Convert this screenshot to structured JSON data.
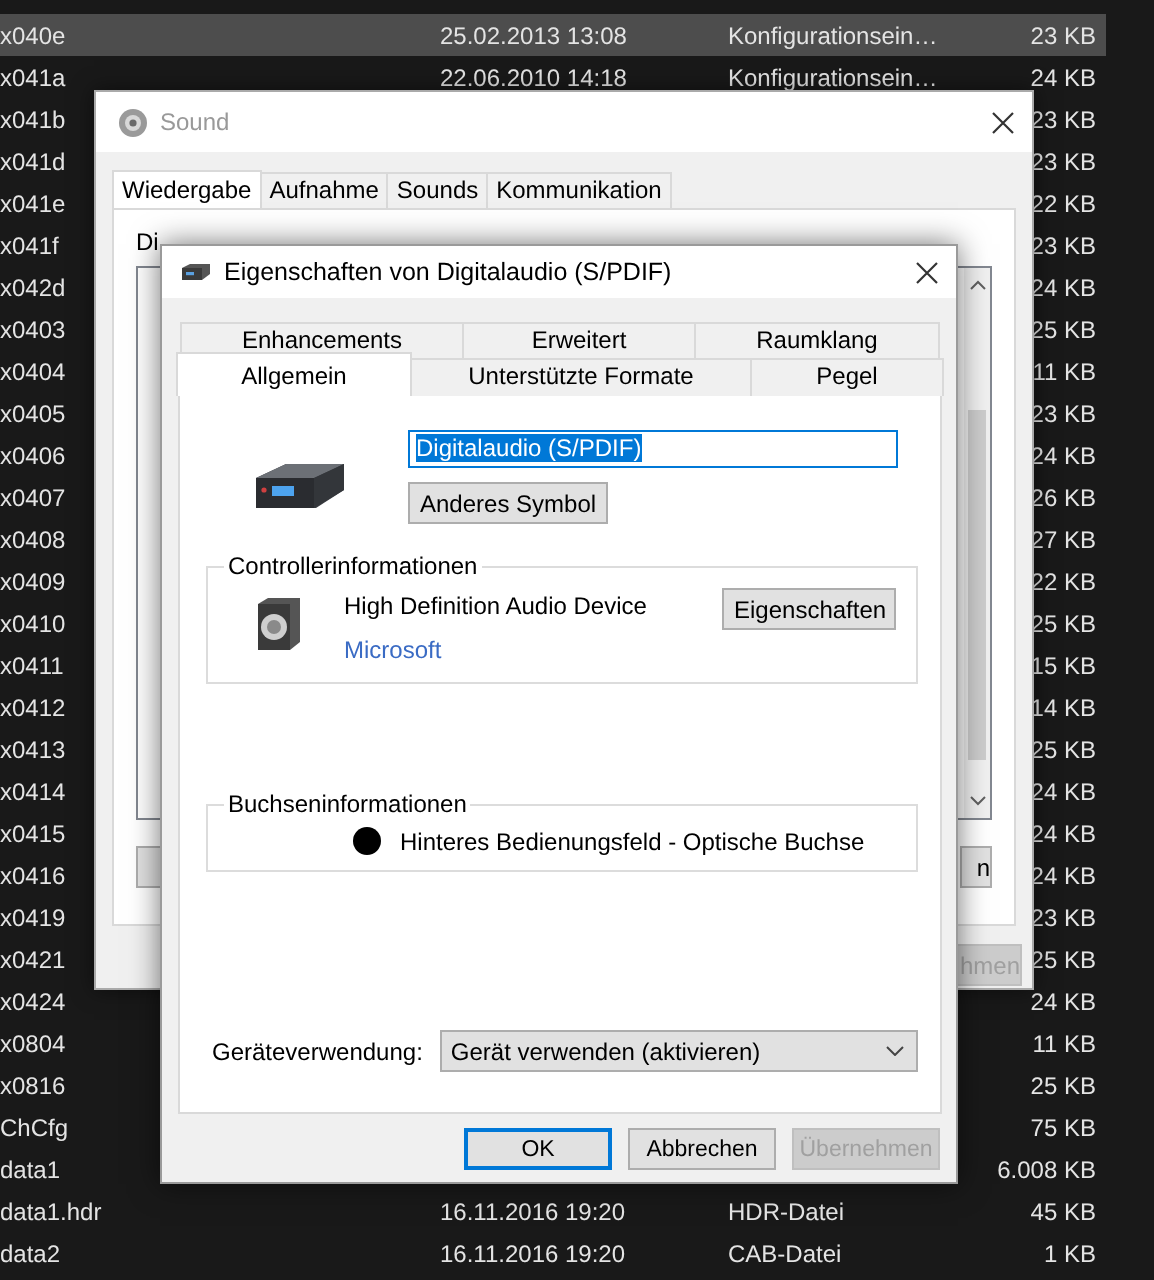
{
  "explorer": {
    "rows": [
      {
        "name": "x040e",
        "date": "25.02.2013 13:08",
        "type": "Konfigurationsein…",
        "size": "23 KB",
        "selected": true
      },
      {
        "name": "x041a",
        "date": "22.06.2010 14:18",
        "type": "Konfigurationsein…",
        "size": "24 KB",
        "selected": false
      },
      {
        "name": "x041b",
        "size": "23 KB",
        "selected": false
      },
      {
        "name": "x041d",
        "size": "23 KB",
        "selected": false
      },
      {
        "name": "x041e",
        "size": "22 KB",
        "selected": false
      },
      {
        "name": "x041f",
        "size": "23 KB",
        "selected": false
      },
      {
        "name": "x042d",
        "size": "24 KB",
        "selected": false
      },
      {
        "name": "x0403",
        "size": "25 KB",
        "selected": false
      },
      {
        "name": "x0404",
        "size": "11 KB",
        "selected": false
      },
      {
        "name": "x0405",
        "size": "23 KB",
        "selected": false
      },
      {
        "name": "x0406",
        "size": "24 KB",
        "selected": false
      },
      {
        "name": "x0407",
        "size": "26 KB",
        "selected": false
      },
      {
        "name": "x0408",
        "size": "27 KB",
        "selected": false
      },
      {
        "name": "x0409",
        "size": "22 KB",
        "selected": false
      },
      {
        "name": "x0410",
        "size": "25 KB",
        "selected": false
      },
      {
        "name": "x0411",
        "size": "15 KB",
        "selected": false
      },
      {
        "name": "x0412",
        "size": "14 KB",
        "selected": false
      },
      {
        "name": "x0413",
        "size": "25 KB",
        "selected": false
      },
      {
        "name": "x0414",
        "size": "24 KB",
        "selected": false
      },
      {
        "name": "x0415",
        "size": "24 KB",
        "selected": false
      },
      {
        "name": "x0416",
        "size": "24 KB",
        "selected": false
      },
      {
        "name": "x0419",
        "size": "23 KB",
        "selected": false
      },
      {
        "name": "x0421",
        "size": "25 KB",
        "selected": false
      },
      {
        "name": "x0424",
        "size": "24 KB",
        "selected": false
      },
      {
        "name": "x0804",
        "size": "11 KB",
        "selected": false
      },
      {
        "name": "x0816",
        "size": "25 KB",
        "selected": false
      },
      {
        "name": "ChCfg",
        "size": "75 KB",
        "selected": false
      },
      {
        "name": "data1",
        "size": "6.008 KB",
        "selected": false
      },
      {
        "name": "data1.hdr",
        "date": "16.11.2016 19:20",
        "type": "HDR-Datei",
        "size": "45 KB",
        "selected": false
      },
      {
        "name": "data2",
        "date": "16.11.2016 19:20",
        "type": "CAB-Datei",
        "size": "1 KB",
        "selected": false
      }
    ]
  },
  "sound_window": {
    "title": "Sound",
    "tabs": [
      {
        "label": "Wiedergabe",
        "selected": true
      },
      {
        "label": "Aufnahme",
        "selected": false
      },
      {
        "label": "Sounds",
        "selected": false
      },
      {
        "label": "Kommunikation",
        "selected": false
      }
    ],
    "intro_text": "Di",
    "buttons": [
      {
        "label": "n",
        "disabled": false
      },
      {
        "label": "hmen",
        "disabled": true
      }
    ]
  },
  "dialog": {
    "title": "Eigenschaften von Digitalaudio (S/PDIF)",
    "tabs_back_row": [
      {
        "label": "Enhancements",
        "selected": false
      },
      {
        "label": "Erweitert",
        "selected": false
      },
      {
        "label": "Raumklang",
        "selected": false
      }
    ],
    "tabs_front_row": [
      {
        "label": "Allgemein",
        "selected": true
      },
      {
        "label": "Unterstützte Formate",
        "selected": false
      },
      {
        "label": "Pegel",
        "selected": false
      }
    ],
    "name_field": {
      "value": "Digitalaudio (S/PDIF)",
      "value_selected": true
    },
    "change_icon_button": "Anderes Symbol",
    "controller": {
      "legend": "Controllerinformationen",
      "device": "High Definition Audio Device",
      "vendor": "Microsoft",
      "button": "Eigenschaften"
    },
    "jack": {
      "legend": "Buchseninformationen",
      "text": "Hinteres Bedienungsfeld - Optische Buchse"
    },
    "usage": {
      "label": "Geräteverwendung:",
      "value": "Gerät verwenden (aktivieren)"
    },
    "buttons": [
      {
        "label": "OK",
        "default": true,
        "disabled": false
      },
      {
        "label": "Abbrechen",
        "default": false,
        "disabled": false
      },
      {
        "label": "Übernehmen",
        "default": false,
        "disabled": true
      }
    ]
  }
}
